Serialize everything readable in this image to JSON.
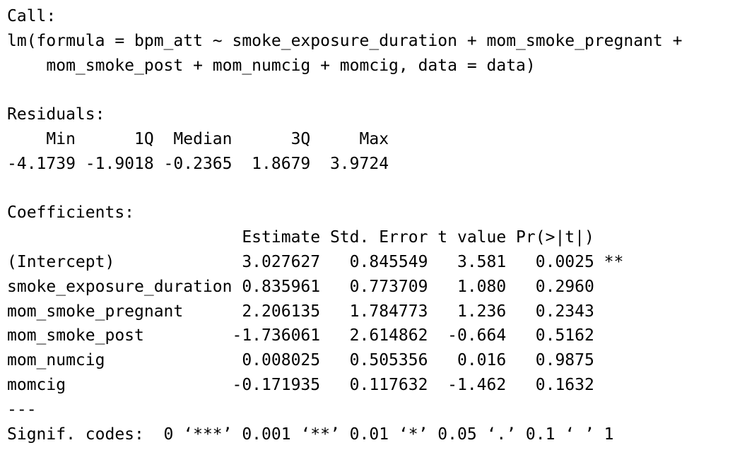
{
  "call": {
    "label": "Call:",
    "formula_line1": "lm(formula = bpm_att ~ smoke_exposure_duration + mom_smoke_pregnant +",
    "formula_line2": "    mom_smoke_post + mom_numcig + momcig, data = data)"
  },
  "residuals": {
    "label": "Residuals:",
    "header": "    Min      1Q  Median      3Q     Max ",
    "values": "-4.1739 -1.9018 -0.2365  1.8679  3.9724 "
  },
  "coefficients": {
    "label": "Coefficients:",
    "header": "                        Estimate Std. Error t value Pr(>|t|)   ",
    "rows": [
      "(Intercept)             3.027627   0.845549   3.581   0.0025 **",
      "smoke_exposure_duration 0.835961   0.773709   1.080   0.2960   ",
      "mom_smoke_pregnant      2.206135   1.784773   1.236   0.2343   ",
      "mom_smoke_post         -1.736061   2.614862  -0.664   0.5162   ",
      "mom_numcig              0.008025   0.505356   0.016   0.9875   ",
      "momcig                 -0.171935   0.117632  -1.462   0.1632   "
    ]
  },
  "signif": {
    "separator": "---",
    "codes": "Signif. codes:  0 ‘***’ 0.001 ‘**’ 0.01 ‘*’ 0.05 ‘.’ 0.1 ‘ ’ 1"
  }
}
